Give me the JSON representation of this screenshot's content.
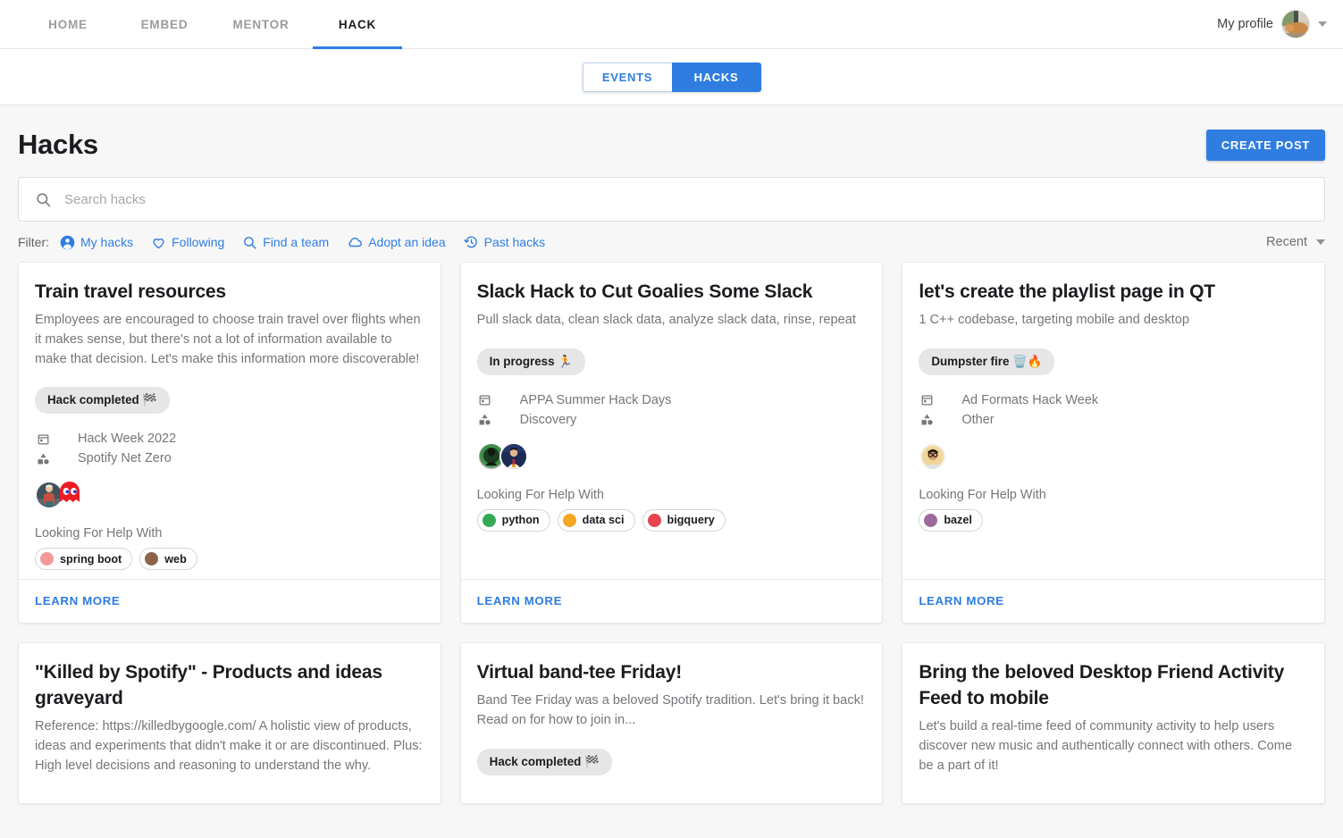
{
  "nav": {
    "tabs": [
      {
        "label": "HOME",
        "active": false
      },
      {
        "label": "EMBED",
        "active": false
      },
      {
        "label": "MENTOR",
        "active": false
      },
      {
        "label": "HACK",
        "active": true
      }
    ],
    "profile_label": "My profile",
    "profile_avatar": "cat-photo-avatar",
    "caret_icon": "chevron-down-icon"
  },
  "segmented": {
    "events_label": "EVENTS",
    "hacks_label": "HACKS",
    "selected": "HACKS"
  },
  "header": {
    "title": "Hacks",
    "create_post_label": "CREATE POST"
  },
  "search": {
    "placeholder": "Search hacks",
    "value": "",
    "icon": "search-icon"
  },
  "filter": {
    "label": "Filter:",
    "items": [
      {
        "label": "My hacks",
        "icon": "person-icon"
      },
      {
        "label": "Following",
        "icon": "heart-outline-icon"
      },
      {
        "label": "Find a team",
        "icon": "search-icon"
      },
      {
        "label": "Adopt an idea",
        "icon": "cloud-outline-icon"
      },
      {
        "label": "Past hacks",
        "icon": "history-icon"
      }
    ],
    "sort_value": "Recent",
    "sort_icon": "chevron-down-icon"
  },
  "colors": {
    "accent_blue": "#2f7de1",
    "page_bg": "#f7f7f8",
    "chip_bg": "#e6e6e7",
    "muted_text": "#75767a"
  },
  "labels": {
    "looking_for_help": "Looking For Help With",
    "learn_more": "LEARN MORE",
    "calendar_icon": "calendar-icon",
    "category_icon": "shapes-category-icon"
  },
  "cards": [
    {
      "title": "Train travel resources",
      "description": "Employees are encouraged to choose train travel over flights when it makes sense, but there's not a lot of information available to make that decision. Let's make this information more discoverable!",
      "status": "Hack completed 🏁",
      "event": "Hack Week 2022",
      "category": "Spotify Net Zero",
      "avatars": [
        "person-photo-avatar",
        "red-pacman-ghost-avatar"
      ],
      "tags": [
        {
          "label": "spring boot",
          "color": "#f4989c"
        },
        {
          "label": "web",
          "color": "#8d6448"
        }
      ],
      "learn_more": "LEARN MORE"
    },
    {
      "title": "Slack Hack to Cut Goalies Some Slack",
      "description": "Pull slack data, clean slack data, analyze slack data, rinse, repeat",
      "status": "In progress 🏃",
      "event": "APPA Summer Hack Days",
      "category": "Discovery",
      "avatars": [
        "green-silhouette-avatar",
        "athlete-photo-avatar"
      ],
      "tags": [
        {
          "label": "python",
          "color": "#35a853"
        },
        {
          "label": "data sci",
          "color": "#f5a623"
        },
        {
          "label": "bigquery",
          "color": "#e4454f"
        }
      ],
      "learn_more": "LEARN MORE"
    },
    {
      "title": "let's create the playlist page in QT",
      "description": "1 C++ codebase, targeting mobile and desktop",
      "status": "Dumpster fire 🗑️🔥",
      "event": "Ad Formats Hack Week",
      "category": "Other",
      "avatars": [
        "person-glasses-photo-avatar"
      ],
      "tags": [
        {
          "label": "bazel",
          "color": "#9b6a9b"
        }
      ],
      "learn_more": "LEARN MORE"
    },
    {
      "title": "\"Killed by Spotify\" - Products and ideas graveyard",
      "description": "Reference: https://killedbygoogle.com/ A holistic view of products, ideas and experiments that didn't make it or are discontinued. Plus: High level decisions and reasoning to understand the why.",
      "status": "",
      "event": "",
      "category": "",
      "avatars": [],
      "tags": [],
      "learn_more": ""
    },
    {
      "title": "Virtual band-tee Friday!",
      "description": "Band Tee Friday was a beloved Spotify tradition. Let's bring it back! Read on for how to join in...",
      "status": "Hack completed 🏁",
      "event": "",
      "category": "",
      "avatars": [],
      "tags": [],
      "learn_more": ""
    },
    {
      "title": "Bring the beloved Desktop Friend Activity Feed to mobile",
      "description": "Let's build a real-time feed of community activity to help users discover new music and authentically connect with others. Come be a part of it!",
      "status": "",
      "event": "",
      "category": "",
      "avatars": [],
      "tags": [],
      "learn_more": ""
    }
  ]
}
